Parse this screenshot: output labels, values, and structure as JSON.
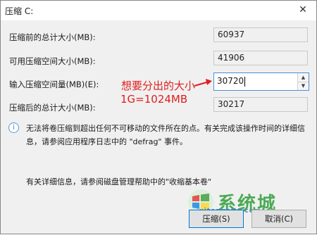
{
  "window": {
    "title": "压缩 C:",
    "close_glyph": "✕"
  },
  "rows": [
    {
      "label": "压缩前的总计大小(MB):",
      "value": "60937"
    },
    {
      "label": "可用压缩空间大小(MB):",
      "value": "41906"
    },
    {
      "label": "输入压缩空间量(MB)(E):",
      "value": "30720"
    },
    {
      "label": "压缩后的总计大小(MB):",
      "value": "30217"
    }
  ],
  "annotation": {
    "line1": "想要分出的大小",
    "line2": "1G=1024MB",
    "color": "#e01e1e"
  },
  "info": {
    "icon": "info-icon",
    "text": "无法将卷压缩到超出任何不可移动的文件所在的点。有关完成该操作时间的详细信息，请参阅应用程序日志中的 \"defrag\" 事件。"
  },
  "bottom_note": "有关详细信息，请参阅磁盘管理帮助中的\"收缩基本卷\"",
  "buttons": {
    "ok": "压缩(S)",
    "cancel": "取消(C)"
  },
  "watermark": {
    "text": "系统城",
    "url": "xitongcity.com"
  },
  "colors": {
    "accent": "#0078d7",
    "annotation": "#e01e1e",
    "dialog_bg": "#f0f0f0"
  }
}
